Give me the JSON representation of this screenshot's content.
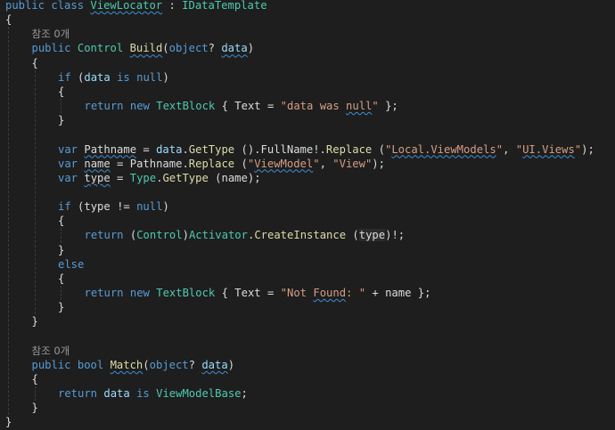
{
  "colors": {
    "background": "#1e1e1e",
    "keyword": "#569cd6",
    "type": "#4ec9b0",
    "method": "#dcdcaa",
    "parameter": "#9cdcfe",
    "string": "#d69d85",
    "plain": "#dcdcdc",
    "codelens": "#999999",
    "squiggle": "#3d8fd6"
  },
  "lines": [
    {
      "indent": 0,
      "tokens": [
        {
          "t": "public",
          "c": "kw"
        },
        {
          "t": " ",
          "c": "plain"
        },
        {
          "t": "class",
          "c": "kw"
        },
        {
          "t": " ",
          "c": "plain"
        },
        {
          "t": "ViewLocator",
          "c": "type",
          "sq": true
        },
        {
          "t": " : ",
          "c": "plain"
        },
        {
          "t": "IDataTemplate",
          "c": "type"
        }
      ]
    },
    {
      "indent": 0,
      "tokens": [
        {
          "t": "{",
          "c": "plain"
        }
      ]
    },
    {
      "indent": 1,
      "lens": true,
      "tokens": [
        {
          "t": "참조 0개",
          "c": "lens"
        }
      ]
    },
    {
      "indent": 1,
      "tokens": [
        {
          "t": "public",
          "c": "kw"
        },
        {
          "t": " ",
          "c": "plain"
        },
        {
          "t": "Control",
          "c": "type"
        },
        {
          "t": " ",
          "c": "plain"
        },
        {
          "t": "Build",
          "c": "method",
          "sq": true
        },
        {
          "t": "(",
          "c": "plain"
        },
        {
          "t": "object",
          "c": "kw"
        },
        {
          "t": "? ",
          "c": "plain"
        },
        {
          "t": "data",
          "c": "param",
          "sq": true
        },
        {
          "t": ")",
          "c": "plain"
        }
      ]
    },
    {
      "indent": 1,
      "tokens": [
        {
          "t": "{",
          "c": "plain"
        }
      ]
    },
    {
      "indent": 2,
      "tokens": [
        {
          "t": "if",
          "c": "kw"
        },
        {
          "t": " (",
          "c": "plain"
        },
        {
          "t": "data",
          "c": "param"
        },
        {
          "t": " ",
          "c": "plain"
        },
        {
          "t": "is",
          "c": "kw"
        },
        {
          "t": " ",
          "c": "plain"
        },
        {
          "t": "null",
          "c": "kw"
        },
        {
          "t": ")",
          "c": "plain"
        }
      ]
    },
    {
      "indent": 2,
      "tokens": [
        {
          "t": "{",
          "c": "plain"
        }
      ]
    },
    {
      "indent": 3,
      "tokens": [
        {
          "t": "return",
          "c": "kw"
        },
        {
          "t": " ",
          "c": "plain"
        },
        {
          "t": "new",
          "c": "kw"
        },
        {
          "t": " ",
          "c": "plain"
        },
        {
          "t": "TextBlock",
          "c": "type"
        },
        {
          "t": " { ",
          "c": "plain"
        },
        {
          "t": "Text",
          "c": "plain"
        },
        {
          "t": " = ",
          "c": "plain"
        },
        {
          "t": "\"data was ",
          "c": "str"
        },
        {
          "t": "null",
          "c": "str",
          "sq": true
        },
        {
          "t": "\"",
          "c": "str"
        },
        {
          "t": " };",
          "c": "plain"
        }
      ]
    },
    {
      "indent": 2,
      "tokens": [
        {
          "t": "}",
          "c": "plain"
        }
      ]
    },
    {
      "indent": 0,
      "tokens": []
    },
    {
      "indent": 2,
      "tokens": [
        {
          "t": "var",
          "c": "kw"
        },
        {
          "t": " ",
          "c": "plain"
        },
        {
          "t": "Pathname",
          "c": "plain",
          "sq": true
        },
        {
          "t": " = ",
          "c": "plain"
        },
        {
          "t": "data",
          "c": "param"
        },
        {
          "t": ".",
          "c": "plain"
        },
        {
          "t": "GetType",
          "c": "method"
        },
        {
          "t": " ().",
          "c": "plain"
        },
        {
          "t": "FullName",
          "c": "plain"
        },
        {
          "t": "!.",
          "c": "plain"
        },
        {
          "t": "Replace",
          "c": "method"
        },
        {
          "t": " (",
          "c": "plain"
        },
        {
          "t": "\"",
          "c": "str"
        },
        {
          "t": "Local.ViewModels",
          "c": "str",
          "sq": true
        },
        {
          "t": "\"",
          "c": "str"
        },
        {
          "t": ", ",
          "c": "plain"
        },
        {
          "t": "\"",
          "c": "str"
        },
        {
          "t": "UI.Views",
          "c": "str",
          "sq": true
        },
        {
          "t": "\"",
          "c": "str"
        },
        {
          "t": ");",
          "c": "plain"
        }
      ]
    },
    {
      "indent": 2,
      "tokens": [
        {
          "t": "var",
          "c": "kw"
        },
        {
          "t": " ",
          "c": "plain"
        },
        {
          "t": "name",
          "c": "plain",
          "sq": true
        },
        {
          "t": " = ",
          "c": "plain"
        },
        {
          "t": "Pathname",
          "c": "plain"
        },
        {
          "t": ".",
          "c": "plain"
        },
        {
          "t": "Replace",
          "c": "method"
        },
        {
          "t": " (",
          "c": "plain"
        },
        {
          "t": "\"",
          "c": "str"
        },
        {
          "t": "ViewModel",
          "c": "str",
          "sq": true
        },
        {
          "t": "\"",
          "c": "str"
        },
        {
          "t": ", ",
          "c": "plain"
        },
        {
          "t": "\"View\"",
          "c": "str"
        },
        {
          "t": ");",
          "c": "plain"
        }
      ]
    },
    {
      "indent": 2,
      "tokens": [
        {
          "t": "var",
          "c": "kw"
        },
        {
          "t": " ",
          "c": "plain"
        },
        {
          "t": "type",
          "c": "plain",
          "sq": true
        },
        {
          "t": " = ",
          "c": "plain"
        },
        {
          "t": "Type",
          "c": "type"
        },
        {
          "t": ".",
          "c": "plain"
        },
        {
          "t": "GetType",
          "c": "method"
        },
        {
          "t": " (",
          "c": "plain"
        },
        {
          "t": "name",
          "c": "plain"
        },
        {
          "t": ");",
          "c": "plain"
        }
      ]
    },
    {
      "indent": 0,
      "tokens": []
    },
    {
      "indent": 2,
      "tokens": [
        {
          "t": "if",
          "c": "kw"
        },
        {
          "t": " (",
          "c": "plain"
        },
        {
          "t": "type",
          "c": "plain"
        },
        {
          "t": " != ",
          "c": "plain"
        },
        {
          "t": "null",
          "c": "kw"
        },
        {
          "t": ")",
          "c": "plain"
        }
      ]
    },
    {
      "indent": 2,
      "tokens": [
        {
          "t": "{",
          "c": "plain"
        }
      ]
    },
    {
      "indent": 3,
      "tokens": [
        {
          "t": "return",
          "c": "kw"
        },
        {
          "t": " (",
          "c": "plain"
        },
        {
          "t": "Control",
          "c": "type"
        },
        {
          "t": ")",
          "c": "plain"
        },
        {
          "t": "Activator",
          "c": "type"
        },
        {
          "t": ".",
          "c": "plain"
        },
        {
          "t": "CreateInstance",
          "c": "method"
        },
        {
          "t": " (",
          "c": "plain"
        },
        {
          "t": "type",
          "c": "plain",
          "hl": true
        },
        {
          "t": ")!;",
          "c": "plain"
        }
      ]
    },
    {
      "indent": 2,
      "tokens": [
        {
          "t": "}",
          "c": "plain"
        }
      ]
    },
    {
      "indent": 2,
      "tokens": [
        {
          "t": "else",
          "c": "kw"
        }
      ]
    },
    {
      "indent": 2,
      "tokens": [
        {
          "t": "{",
          "c": "plain"
        }
      ]
    },
    {
      "indent": 3,
      "tokens": [
        {
          "t": "return",
          "c": "kw"
        },
        {
          "t": " ",
          "c": "plain"
        },
        {
          "t": "new",
          "c": "kw"
        },
        {
          "t": " ",
          "c": "plain"
        },
        {
          "t": "TextBlock",
          "c": "type"
        },
        {
          "t": " { ",
          "c": "plain"
        },
        {
          "t": "Text",
          "c": "plain"
        },
        {
          "t": " = ",
          "c": "plain"
        },
        {
          "t": "\"Not ",
          "c": "str"
        },
        {
          "t": "Found",
          "c": "str",
          "sq": true
        },
        {
          "t": ": \"",
          "c": "str"
        },
        {
          "t": " + ",
          "c": "plain"
        },
        {
          "t": "name",
          "c": "plain"
        },
        {
          "t": " };",
          "c": "plain"
        }
      ]
    },
    {
      "indent": 2,
      "tokens": [
        {
          "t": "}",
          "c": "plain"
        }
      ]
    },
    {
      "indent": 1,
      "tokens": [
        {
          "t": "}",
          "c": "plain"
        }
      ]
    },
    {
      "indent": 0,
      "tokens": []
    },
    {
      "indent": 1,
      "lens": true,
      "tokens": [
        {
          "t": "참조 0개",
          "c": "lens"
        }
      ]
    },
    {
      "indent": 1,
      "tokens": [
        {
          "t": "public",
          "c": "kw"
        },
        {
          "t": " ",
          "c": "plain"
        },
        {
          "t": "bool",
          "c": "kw"
        },
        {
          "t": " ",
          "c": "plain"
        },
        {
          "t": "Match",
          "c": "method",
          "sq": true
        },
        {
          "t": "(",
          "c": "plain"
        },
        {
          "t": "object",
          "c": "kw"
        },
        {
          "t": "? ",
          "c": "plain"
        },
        {
          "t": "data",
          "c": "param",
          "sq": true
        },
        {
          "t": ")",
          "c": "plain"
        }
      ]
    },
    {
      "indent": 1,
      "tokens": [
        {
          "t": "{",
          "c": "plain"
        }
      ]
    },
    {
      "indent": 2,
      "tokens": [
        {
          "t": "return",
          "c": "kw"
        },
        {
          "t": " ",
          "c": "plain"
        },
        {
          "t": "data",
          "c": "param"
        },
        {
          "t": " ",
          "c": "plain"
        },
        {
          "t": "is",
          "c": "kw"
        },
        {
          "t": " ",
          "c": "plain"
        },
        {
          "t": "ViewModelBase",
          "c": "type"
        },
        {
          "t": ";",
          "c": "plain"
        }
      ]
    },
    {
      "indent": 1,
      "tokens": [
        {
          "t": "}",
          "c": "plain"
        }
      ]
    },
    {
      "indent": 0,
      "tokens": [
        {
          "t": "}",
          "c": "plain"
        }
      ]
    }
  ]
}
